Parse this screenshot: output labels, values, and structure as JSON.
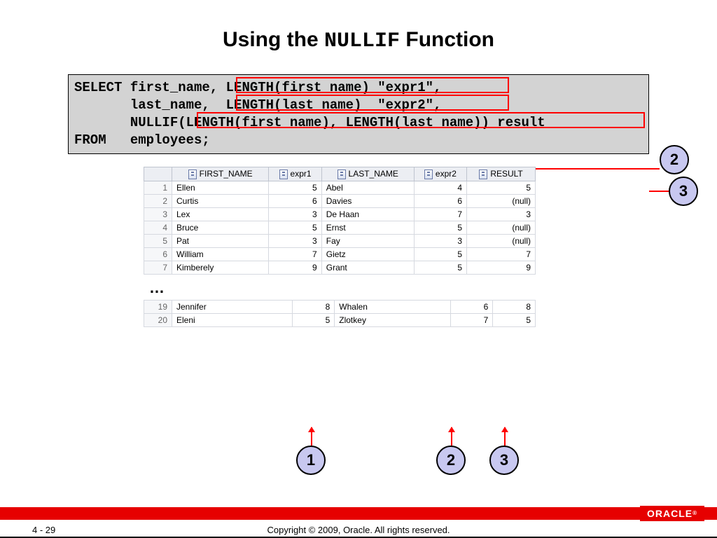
{
  "title": {
    "pre": "Using the ",
    "mono": "NULLIF",
    "post": " Function"
  },
  "code": "SELECT first_name, LENGTH(first_name) \"expr1\",\n       last_name,  LENGTH(last_name)  \"expr2\",\n       NULLIF(LENGTH(first_name), LENGTH(last_name)) result\nFROM   employees;",
  "badges": {
    "b1": "1",
    "b2": "2",
    "b3": "3",
    "c1": "1",
    "c2": "2",
    "c3": "3"
  },
  "headers": [
    "FIRST_NAME",
    "expr1",
    "LAST_NAME",
    "expr2",
    "RESULT"
  ],
  "rows_top": [
    {
      "n": "1",
      "first_name": "Ellen",
      "expr1": "5",
      "last_name": "Abel",
      "expr2": "4",
      "result": "5"
    },
    {
      "n": "2",
      "first_name": "Curtis",
      "expr1": "6",
      "last_name": "Davies",
      "expr2": "6",
      "result": "(null)"
    },
    {
      "n": "3",
      "first_name": "Lex",
      "expr1": "3",
      "last_name": "De Haan",
      "expr2": "7",
      "result": "3"
    },
    {
      "n": "4",
      "first_name": "Bruce",
      "expr1": "5",
      "last_name": "Ernst",
      "expr2": "5",
      "result": "(null)"
    },
    {
      "n": "5",
      "first_name": "Pat",
      "expr1": "3",
      "last_name": "Fay",
      "expr2": "3",
      "result": "(null)"
    },
    {
      "n": "6",
      "first_name": "William",
      "expr1": "7",
      "last_name": "Gietz",
      "expr2": "5",
      "result": "7"
    },
    {
      "n": "7",
      "first_name": "Kimberely",
      "expr1": "9",
      "last_name": "Grant",
      "expr2": "5",
      "result": "9"
    }
  ],
  "ellipsis": "…",
  "rows_bottom": [
    {
      "n": "19",
      "first_name": "Jennifer",
      "expr1": "8",
      "last_name": "Whalen",
      "expr2": "6",
      "result": "8"
    },
    {
      "n": "20",
      "first_name": "Eleni",
      "expr1": "5",
      "last_name": "Zlotkey",
      "expr2": "7",
      "result": "5"
    }
  ],
  "footer": {
    "page": "4 - 29",
    "copy": "Copyright © 2009, Oracle. All rights reserved.",
    "brand": "ORACLE"
  }
}
